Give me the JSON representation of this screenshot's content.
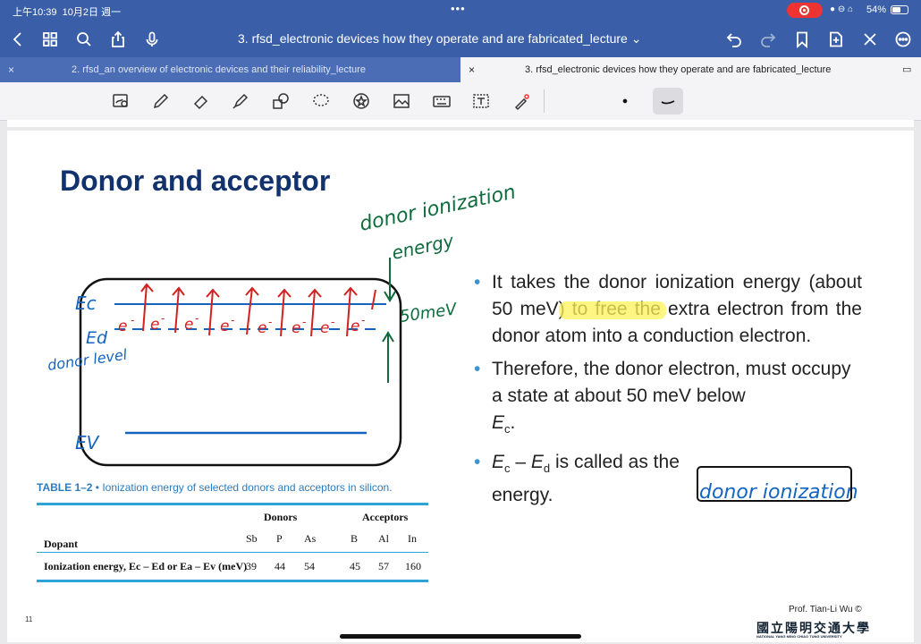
{
  "status": {
    "time": "上午10:39",
    "date": "10月2日 週一",
    "battery": "54%"
  },
  "nav": {
    "title": "3. rfsd_electronic devices how they operate and are fabricated_lecture"
  },
  "tabs": [
    {
      "label": "2. rfsd_an overview of electronic devices and their reliability_lecture"
    },
    {
      "label": "3. rfsd_electronic devices how they operate and are fabricated_lecture"
    }
  ],
  "colors": {
    "header": "#3a5fa8",
    "title": "#12326e",
    "bullet": "#3a94d0",
    "ink_blue": "#1565c0",
    "ink_green": "#0f6b3c",
    "ink_red": "#d32020",
    "highlight": "#fff25a"
  },
  "slide": {
    "title": "Donor and acceptor",
    "bullet1": "It takes the donor ionization energy (about 50 meV) to free the extra electron from the donor atom into a conduction electron.",
    "bullet2": "Therefore, the donor electron, must occupy a state at about 50 meV below",
    "bullet2_ec": "E",
    "bullet2_ec_sub": "c",
    "bullet3_a": "E",
    "bullet3_a_sub": "c",
    "bullet3_dash": " – ",
    "bullet3_b": "E",
    "bullet3_b_sub": "d",
    "bullet3_rest": " is called as the",
    "bullet3_end": "energy.",
    "table_caption_num": "TABLE 1–2",
    "table_caption_text": "Ionization energy of selected donors and acceptors in silicon.",
    "table": {
      "group_donors": "Donors",
      "group_acceptors": "Acceptors",
      "row1_label": "Dopant",
      "dopants": [
        "Sb",
        "P",
        "As",
        "B",
        "Al",
        "In"
      ],
      "row2_label": "Ionization energy, E",
      "row2_label_full": "Ionization energy, Ec – Ed or Ea – Ev (meV)",
      "energies": [
        "39",
        "44",
        "54",
        "45",
        "57",
        "160"
      ]
    },
    "author": "Prof. Tian-Li Wu ©",
    "university": "國立陽明交通大學",
    "university_en": "NATIONAL YANG MING CHIAO TUNG UNIVERSITY",
    "page": "11"
  },
  "annotations": {
    "green_top": "donor ionization",
    "green_energy": "energy",
    "green_50": "50meV",
    "ec": "Ec",
    "ed": "Ed",
    "donor_level": "donor level",
    "ev": "EV",
    "blue_box": "donor ionization"
  }
}
